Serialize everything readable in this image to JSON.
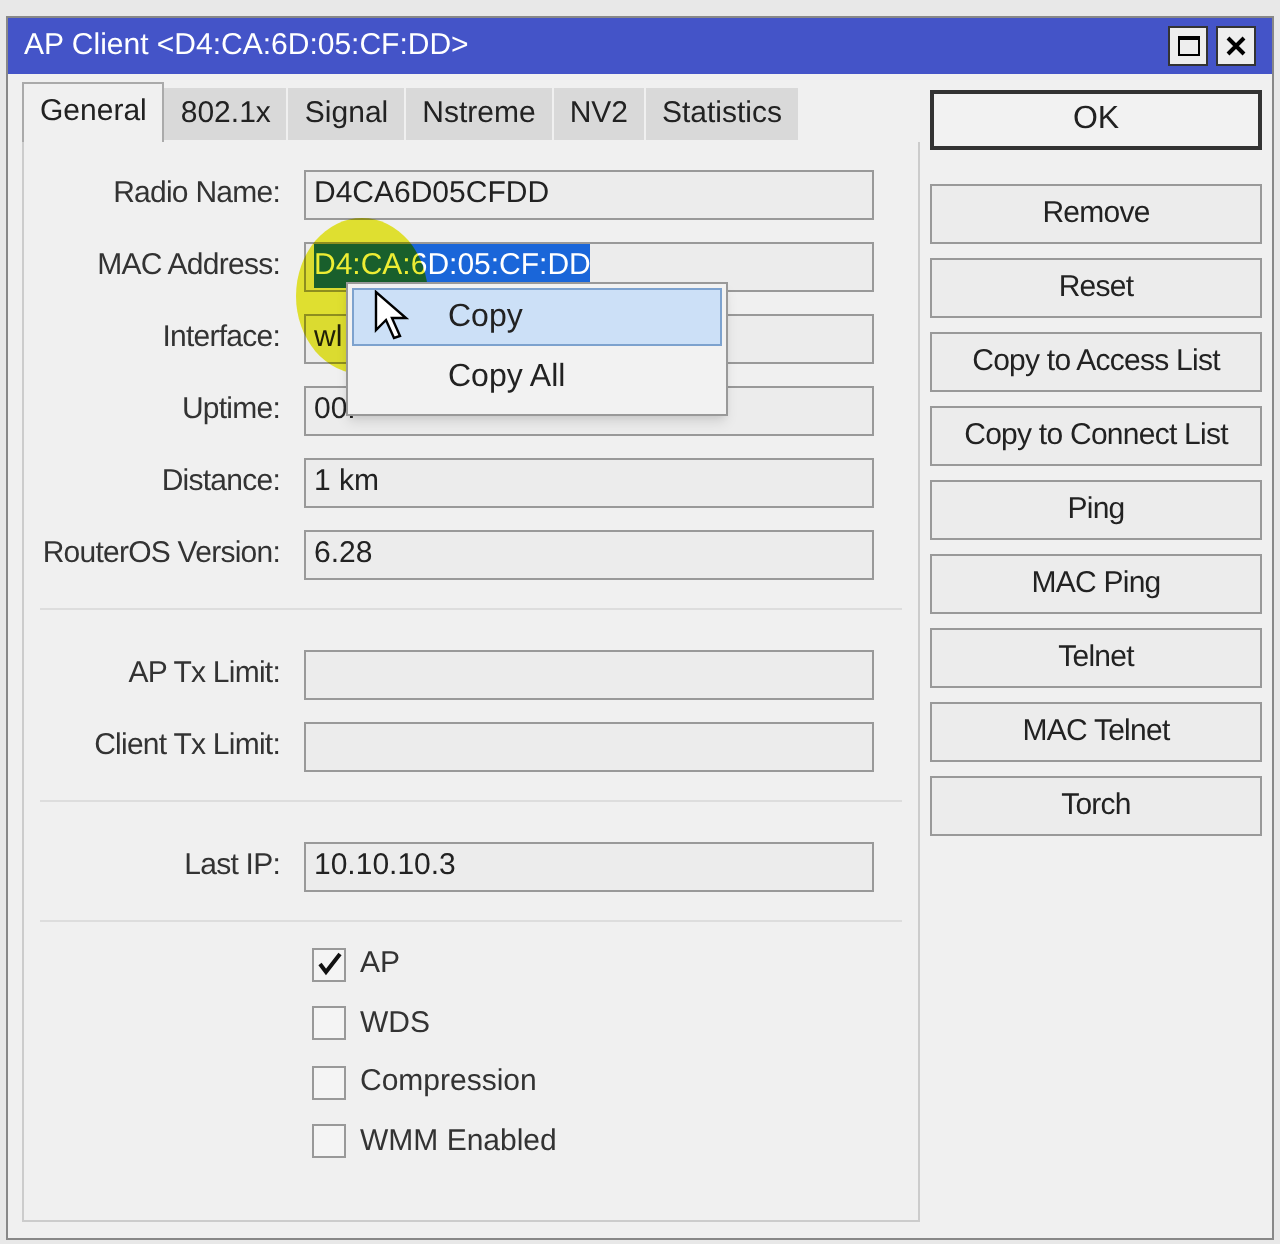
{
  "window": {
    "title": "AP Client <D4:CA:6D:05:CF:DD>"
  },
  "tabs": [
    {
      "label": "General",
      "selected": true
    },
    {
      "label": "802.1x",
      "selected": false
    },
    {
      "label": "Signal",
      "selected": false
    },
    {
      "label": "Nstreme",
      "selected": false
    },
    {
      "label": "NV2",
      "selected": false
    },
    {
      "label": "Statistics",
      "selected": false
    }
  ],
  "field_groups": [
    [
      {
        "label": "Radio Name:",
        "value": "D4CA6D05CFDD"
      },
      {
        "label": "MAC Address:",
        "value": "D4:CA:6D:05:CF:DD",
        "text_selected": true
      },
      {
        "label": "Interface:",
        "value": "wl"
      },
      {
        "label": "Uptime:",
        "value": "00:"
      },
      {
        "label": "Distance:",
        "value": "1 km"
      },
      {
        "label": "RouterOS Version:",
        "value": "6.28"
      }
    ],
    [
      {
        "label": "AP Tx Limit:"
      },
      {
        "label": "Client Tx Limit:"
      }
    ],
    [
      {
        "label": "Last IP:",
        "value": "10.10.10.3"
      }
    ]
  ],
  "checkboxes": [
    {
      "label": "AP",
      "checked": true
    },
    {
      "label": "WDS",
      "checked": false
    },
    {
      "label": "Compression",
      "checked": false
    },
    {
      "label": "WMM Enabled",
      "checked": false
    }
  ],
  "buttons": [
    "OK",
    "Remove",
    "Reset",
    "Copy to Access List",
    "Copy to Connect List",
    "Ping",
    "MAC Ping",
    "Telnet",
    "MAC Telnet",
    "Torch"
  ],
  "context_menu": [
    {
      "label": "Copy",
      "selected": true
    },
    {
      "label": "Copy All",
      "selected": false
    }
  ]
}
